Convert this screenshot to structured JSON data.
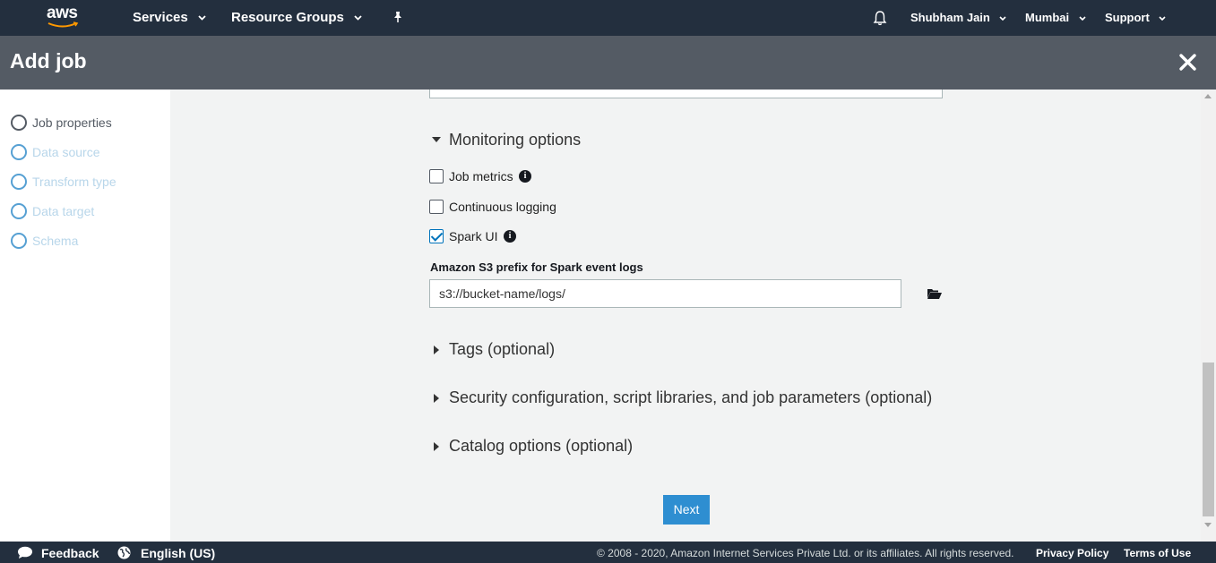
{
  "topnav": {
    "logo": "aws",
    "services": "Services",
    "resource_groups": "Resource Groups",
    "user": "Shubham Jain",
    "region": "Mumbai",
    "support": "Support"
  },
  "header": {
    "title": "Add job"
  },
  "sidebar": {
    "steps": [
      {
        "label": "Job properties"
      },
      {
        "label": "Data source"
      },
      {
        "label": "Transform type"
      },
      {
        "label": "Data target"
      },
      {
        "label": "Schema"
      }
    ]
  },
  "main": {
    "monitoring": {
      "title": "Monitoring options",
      "job_metrics": "Job metrics",
      "continuous_logging": "Continuous logging",
      "spark_ui": "Spark UI",
      "s3_label": "Amazon S3 prefix for Spark event logs",
      "s3_value": "s3://bucket-name/logs/"
    },
    "tags": "Tags (optional)",
    "security": "Security configuration, script libraries, and job parameters (optional)",
    "catalog": "Catalog options (optional)",
    "next": "Next"
  },
  "footer": {
    "feedback": "Feedback",
    "language": "English (US)",
    "copyright": "© 2008 - 2020, Amazon Internet Services Private Ltd. or its affiliates. All rights reserved.",
    "privacy": "Privacy Policy",
    "terms": "Terms of Use"
  },
  "colors": {
    "nav_bg": "#232f3e",
    "header_bg": "#545b64",
    "accent": "#2e8ed1"
  }
}
